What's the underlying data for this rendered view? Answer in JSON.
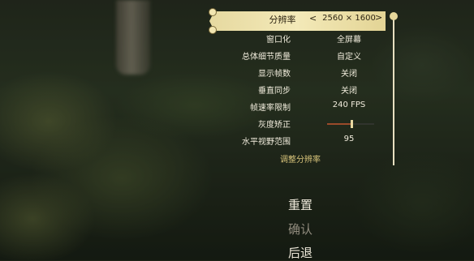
{
  "settings": {
    "selected": {
      "label": "分辨率",
      "left_arrow": "<",
      "value": "2560 × 1600",
      "right_arrow": ">"
    },
    "rows": [
      {
        "label": "窗口化",
        "value": "全屏幕"
      },
      {
        "label": "总体细节质量",
        "value": "自定义"
      },
      {
        "label": "显示帧数",
        "value": "关闭"
      },
      {
        "label": "垂直同步",
        "value": "关闭"
      },
      {
        "label": "帧速率限制",
        "value": "240 FPS"
      },
      {
        "label": "灰度矫正",
        "value": ""
      },
      {
        "label": "水平视野范围",
        "value": "95"
      }
    ],
    "gamma_level": 0.52,
    "adjust_link": "调整分辨率"
  },
  "menu": {
    "reset": "重置",
    "confirm": "确认",
    "back": "后退"
  },
  "colors": {
    "panel_highlight": "#efe3ad",
    "accent_gold": "#d8c47a",
    "slider_fill": "#9a4a2a"
  }
}
